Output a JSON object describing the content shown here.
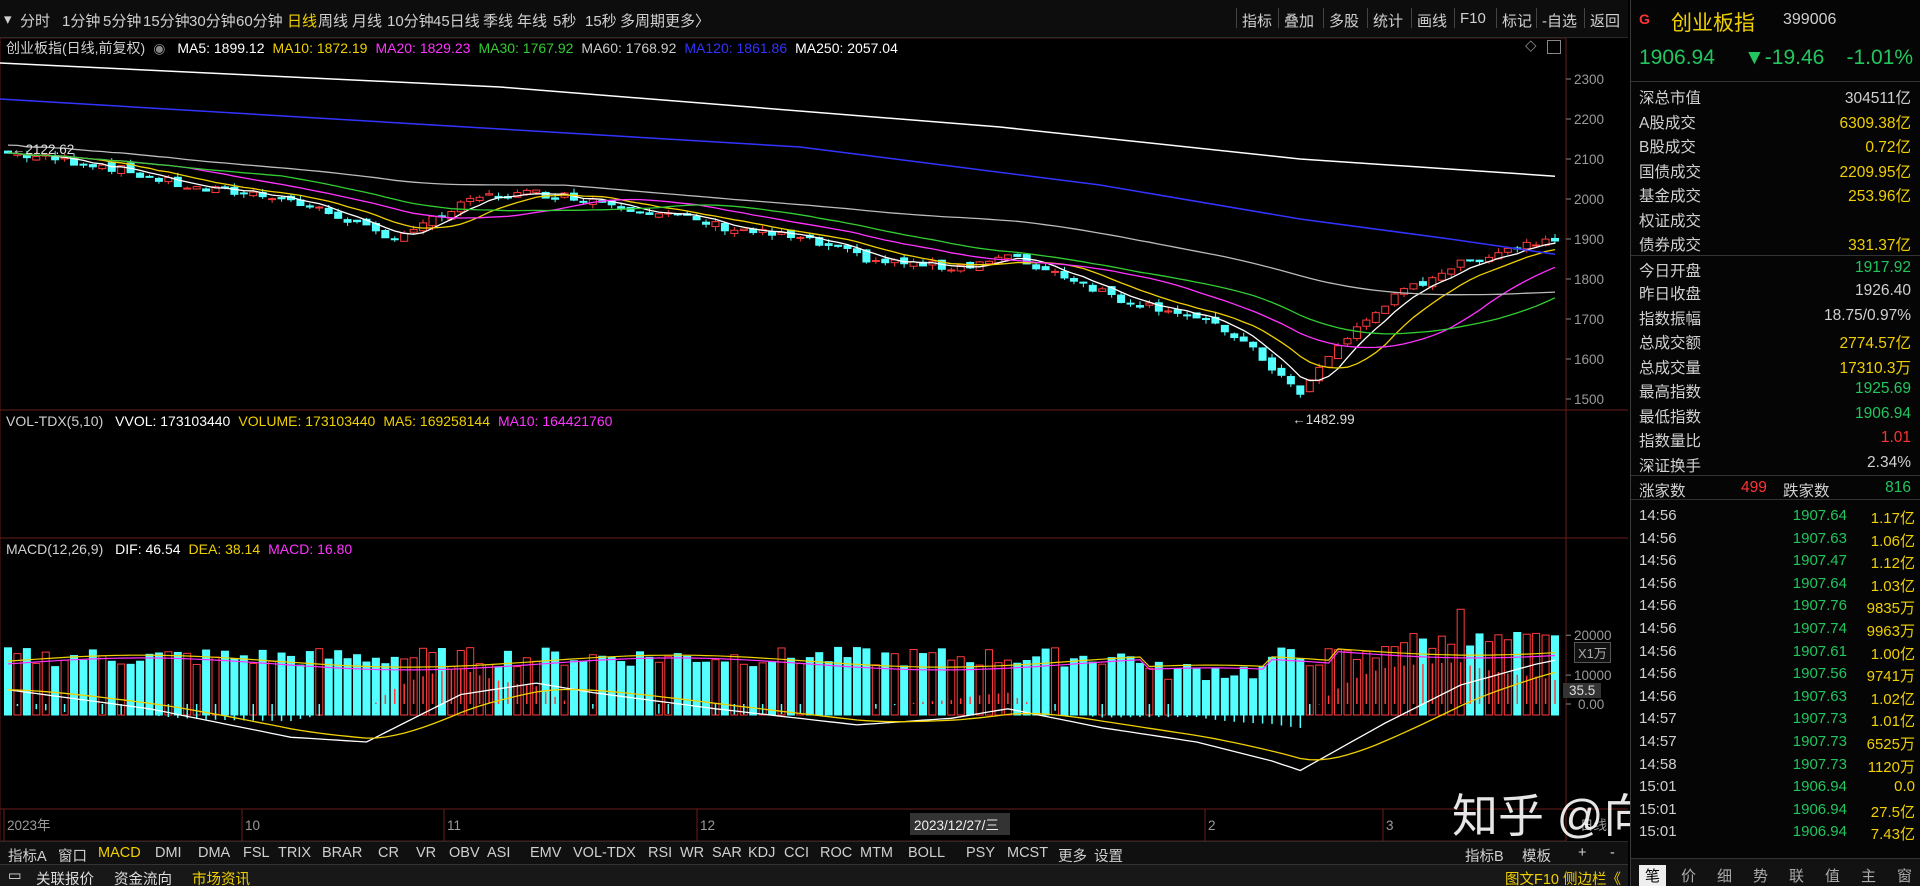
{
  "toolbar": {
    "left": [
      "分时",
      "1分钟",
      "5分钟",
      "15分钟",
      "30分钟",
      "60分钟",
      "日线",
      "周线",
      "月线",
      "10分钟",
      "45日线",
      "季线",
      "年线",
      "5秒",
      "15秒",
      "多周期",
      "更多〉"
    ],
    "active": "日线",
    "right": [
      "指标",
      "叠加",
      "多股",
      "统计",
      "画线",
      "F10",
      "标记",
      "-自选",
      "返回"
    ]
  },
  "main_legend": {
    "name": "创业板指(日线,前复权)",
    "ma": [
      {
        "label": "MA5: 1899.12",
        "color": "#ffffff"
      },
      {
        "label": "MA10: 1872.19",
        "color": "#f0d000"
      },
      {
        "label": "MA20: 1829.23",
        "color": "#ff33ff"
      },
      {
        "label": "MA30: 1767.92",
        "color": "#33cc33"
      },
      {
        "label": "MA60: 1768.92",
        "color": "#cccccc"
      },
      {
        "label": "MA120: 1861.86",
        "color": "#3333ff"
      },
      {
        "label": "MA250: 2057.04",
        "color": "#ffffff"
      }
    ]
  },
  "price_axis": [
    "2300",
    "2200",
    "2100",
    "2000",
    "1900",
    "1800",
    "1700",
    "1600",
    "1500"
  ],
  "annotations": {
    "high": "2122.62",
    "low": "1482.99"
  },
  "vol_legend": {
    "name": "VOL-TDX(5,10)",
    "items": [
      {
        "label": "VVOL: 173103440",
        "color": "#ffffff"
      },
      {
        "label": "VOLUME: 173103440",
        "color": "#f0d000"
      },
      {
        "label": "MA5: 169258144",
        "color": "#f0d000"
      },
      {
        "label": "MA10: 164421760",
        "color": "#ff33ff"
      }
    ],
    "axis": [
      "20000",
      "10000"
    ],
    "unit": "X1万"
  },
  "macd_legend": {
    "name": "MACD(12,26,9)",
    "items": [
      {
        "label": "DIF: 46.54",
        "color": "#ffffff"
      },
      {
        "label": "DEA: 38.14",
        "color": "#f0d000"
      },
      {
        "label": "MACD: 16.80",
        "color": "#ff33ff"
      }
    ],
    "axis": [
      "35.5",
      "0.00"
    ]
  },
  "date_axis": {
    "labels": [
      "2023年",
      "10",
      "11",
      "12",
      "2",
      "3"
    ],
    "cursor": "2023/12/27/三",
    "period": "日线"
  },
  "indicator_tabs": {
    "left": [
      "指标A",
      "窗口",
      "MACD",
      "DMI",
      "DMA",
      "FSL",
      "TRIX",
      "BRAR",
      "CR",
      "VR",
      "OBV",
      "ASI",
      "EMV",
      "VOL-TDX",
      "RSI",
      "WR",
      "SAR",
      "KDJ",
      "CCI",
      "ROC",
      "MTM",
      "BOLL",
      "PSY",
      "MCST",
      "更多",
      "设置"
    ],
    "active": "MACD",
    "right": [
      "指标B",
      "模板",
      "+",
      "-"
    ]
  },
  "status_bar": {
    "items": [
      "关联报价",
      "资金流向",
      "市场资讯"
    ],
    "active": "市场资讯",
    "right": "图文F10 侧边栏《"
  },
  "side": {
    "badge": "G",
    "index_name": "创业板指",
    "index_code": "399006",
    "price": "1906.94",
    "change": "▼-19.46",
    "change_pct": "-1.01%",
    "stats": [
      {
        "k": "深总市值",
        "v": "304511亿",
        "c": "#d0d0d0"
      },
      {
        "k": "A股成交",
        "v": "6309.38亿",
        "c": "#f0d000"
      },
      {
        "k": "B股成交",
        "v": "0.72亿",
        "c": "#f0d000"
      },
      {
        "k": "国债成交",
        "v": "2209.95亿",
        "c": "#f0d000"
      },
      {
        "k": "基金成交",
        "v": "253.96亿",
        "c": "#f0d000"
      },
      {
        "k": "权证成交",
        "v": "",
        "c": "#f0d000"
      },
      {
        "k": "债券成交",
        "v": "331.37亿",
        "c": "#f0d000"
      },
      {
        "k": "今日开盘",
        "v": "1917.92",
        "c": "#22c55e"
      },
      {
        "k": "昨日收盘",
        "v": "1926.40",
        "c": "#d0d0d0"
      },
      {
        "k": "指数振幅",
        "v": "18.75/0.97%",
        "c": "#d0d0d0"
      },
      {
        "k": "总成交额",
        "v": "2774.57亿",
        "c": "#f0d000"
      },
      {
        "k": "总成交量",
        "v": "17310.3万",
        "c": "#f0d000"
      },
      {
        "k": "最高指数",
        "v": "1925.69",
        "c": "#22c55e"
      },
      {
        "k": "最低指数",
        "v": "1906.94",
        "c": "#22c55e"
      },
      {
        "k": "指数量比",
        "v": "1.01",
        "c": "#ff3333"
      },
      {
        "k": "深证换手",
        "v": "2.34%",
        "c": "#d0d0d0"
      }
    ],
    "advance_label": "涨家数",
    "advance": "499",
    "decline_label": "跌家数",
    "decline": "816",
    "ticks": [
      {
        "t": "14:56",
        "p": "1907.64",
        "v": "1.17亿"
      },
      {
        "t": "14:56",
        "p": "1907.63",
        "v": "1.06亿"
      },
      {
        "t": "14:56",
        "p": "1907.47",
        "v": "1.12亿"
      },
      {
        "t": "14:56",
        "p": "1907.64",
        "v": "1.03亿"
      },
      {
        "t": "14:56",
        "p": "1907.76",
        "v": "9835万"
      },
      {
        "t": "14:56",
        "p": "1907.74",
        "v": "9963万"
      },
      {
        "t": "14:56",
        "p": "1907.61",
        "v": "1.00亿"
      },
      {
        "t": "14:56",
        "p": "1907.56",
        "v": "9741万"
      },
      {
        "t": "14:56",
        "p": "1907.63",
        "v": "1.02亿"
      },
      {
        "t": "14:57",
        "p": "1907.73",
        "v": "1.01亿"
      },
      {
        "t": "14:57",
        "p": "1907.73",
        "v": "6525万"
      },
      {
        "t": "14:58",
        "p": "1907.73",
        "v": "1120万"
      },
      {
        "t": "15:01",
        "p": "1906.94",
        "v": "0.0"
      },
      {
        "t": "15:01",
        "p": "1906.94",
        "v": "27.5亿"
      },
      {
        "t": "15:01",
        "p": "1906.94",
        "v": "7.43亿"
      }
    ],
    "tabs": [
      "笔",
      "价",
      "细",
      "势",
      "联",
      "值",
      "主",
      "窗"
    ]
  },
  "watermark": "知乎 @向庄起武"
}
